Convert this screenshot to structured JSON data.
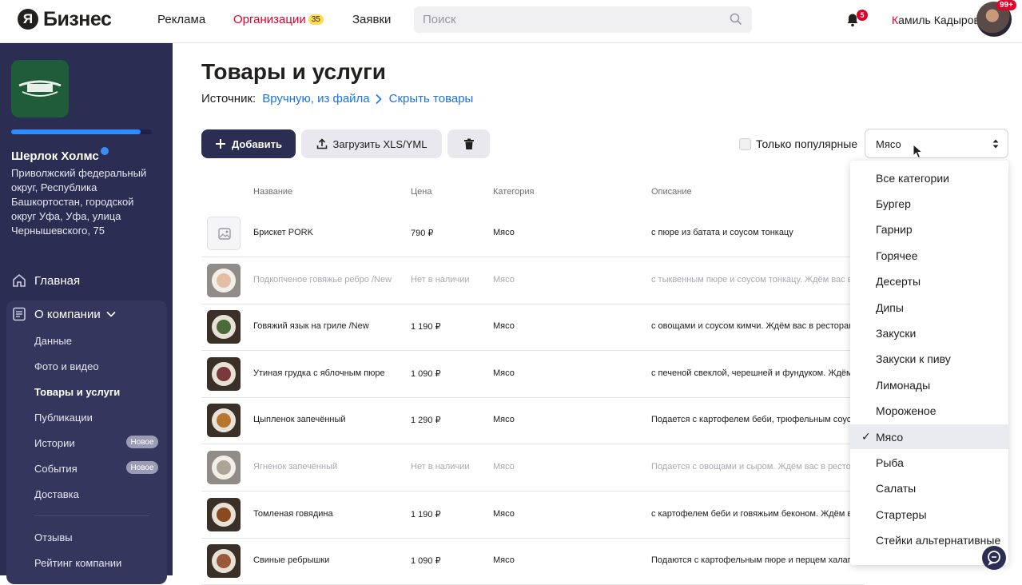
{
  "header": {
    "logo_letter": "Я",
    "logo_text": "Бизнес",
    "nav": [
      {
        "label": "Реклама"
      },
      {
        "label": "Организации",
        "badge": "35"
      },
      {
        "label": "Заявки"
      }
    ],
    "search_placeholder": "Поиск",
    "notifications_count": "5",
    "user_first_letter": "К",
    "user_name_rest": "амиль Кадыров",
    "avatar_badge": "99+"
  },
  "sidebar": {
    "org_name": "Шерлок Холмс",
    "org_address": "Приволжский федеральный округ, Республика Башкортостан, городской округ Уфа, Уфа, улица Чернышевского, 75",
    "profile_progress": 0.92,
    "main_label": "Главная",
    "about_label": "О компании",
    "sub_items": [
      {
        "label": "Данные"
      },
      {
        "label": "Фото и видео"
      },
      {
        "label": "Товары и услуги",
        "active": true
      },
      {
        "label": "Публикации"
      },
      {
        "label": "Истории",
        "badge": "Новое"
      },
      {
        "label": "События",
        "badge": "Новое"
      },
      {
        "label": "Доставка"
      }
    ],
    "extra_items": [
      {
        "label": "Отзывы"
      },
      {
        "label": "Рейтинг компании"
      }
    ]
  },
  "main": {
    "title": "Товары и услуги",
    "source_label": "Источник:",
    "source_link": "Вручную, из файла",
    "hide_link": "Скрыть товары",
    "add_button": "Добавить",
    "upload_button": "Загрузить XLS/YML",
    "popular_label": "Только популярные",
    "category_value": "Мясо",
    "columns": {
      "name": "Название",
      "price": "Цена",
      "category": "Категория",
      "description": "Описание"
    },
    "rows": [
      {
        "name": "Брискет PORK",
        "price": "790 ₽",
        "category": "Мясо",
        "description": "с пюре из батата и соусом тонкацу",
        "available": true,
        "thumb": "empty"
      },
      {
        "name": "Подкопченое говяжье ребро /New",
        "price": "Нет в наличии",
        "category": "Мясо",
        "description": "с тыквенным пюре и соусом тонкацу. Ждём вас в",
        "available": false,
        "thumb": "#c98a5c"
      },
      {
        "name": "Говяжий язык на гриле /New",
        "price": "1 190 ₽",
        "category": "Мясо",
        "description": "с овощами и соусом кимчи. Ждём вас в ресторан",
        "available": true,
        "thumb": "#4b6a3a"
      },
      {
        "name": "Утиная грудка с яблочным пюре",
        "price": "1 090 ₽",
        "category": "Мясо",
        "description": "с печеной свеклой, черешней и фундуком. Ждём",
        "available": true,
        "thumb": "#7a3a3a"
      },
      {
        "name": "Цыпленок запечённый",
        "price": "1 290 ₽",
        "category": "Мясо",
        "description": "Подается с картофелем беби, трюфельным соусо",
        "available": true,
        "thumb": "#b8762f"
      },
      {
        "name": "Ягненок запечённый",
        "price": "Нет в наличии",
        "category": "Мясо",
        "description": "Подается с овощами и сыром. Ждём вас в рестор",
        "available": false,
        "thumb": "#6a5a40"
      },
      {
        "name": "Томленая говядина",
        "price": "1 190 ₽",
        "category": "Мясо",
        "description": "с картофелем беби и говяжьим беконом. Ждём в",
        "available": true,
        "thumb": "#8a4a20"
      },
      {
        "name": "Свиные ребрышки",
        "price": "1 090 ₽",
        "category": "Мясо",
        "description": "Подаются с картофельным пюре и перцем халапе",
        "available": true,
        "thumb": "#9a5a3a"
      }
    ]
  },
  "dropdown": {
    "items": [
      {
        "label": "Все категории"
      },
      {
        "label": "Бургер"
      },
      {
        "label": "Гарнир"
      },
      {
        "label": "Горячее"
      },
      {
        "label": "Десерты"
      },
      {
        "label": "Дипы"
      },
      {
        "label": "Закуски"
      },
      {
        "label": "Закуски к пиву"
      },
      {
        "label": "Лимонады"
      },
      {
        "label": "Мороженое"
      },
      {
        "label": "Мясо",
        "selected": true
      },
      {
        "label": "Рыба"
      },
      {
        "label": "Салаты"
      },
      {
        "label": "Стартеры"
      },
      {
        "label": "Стейки альтернативные"
      }
    ],
    "check_glyph": "✓"
  },
  "colors": {
    "sidebar_bg": "#2b2d52",
    "accent_red": "#e0002a",
    "link_blue": "#1a73e8",
    "badge_yellow": "#ffdb4d"
  }
}
